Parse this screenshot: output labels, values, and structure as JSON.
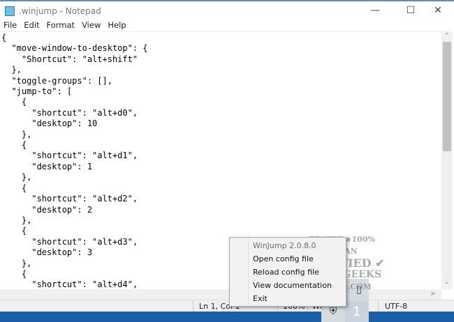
{
  "window": {
    "title": ".winjump - Notepad",
    "controls": [
      "minimize",
      "maximize",
      "close"
    ]
  },
  "menu": [
    "File",
    "Edit",
    "Format",
    "View",
    "Help"
  ],
  "editor": {
    "content": "{\n  \"move-window-to-desktop\": {\n    \"Shortcut\": \"alt+shift\"\n  },\n  \"toggle-groups\": [],\n  \"jump-to\": [\n    {\n      \"shortcut\": \"alt+d0\",\n      \"desktop\": 10\n    },\n    {\n      \"shortcut\": \"alt+d1\",\n      \"desktop\": 1\n    },\n    {\n      \"shortcut\": \"alt+d2\",\n      \"desktop\": 2\n    },\n    {\n      \"shortcut\": \"alt+d3\",\n      \"desktop\": 3\n    },\n    {\n      \"shortcut\": \"alt+d4\","
  },
  "status": {
    "position": "Ln 1, Col 1",
    "zoom": "100%",
    "line_ending": "Wi",
    "encoding": "UTF-8"
  },
  "context_menu": {
    "header": "WinJump 2.0.8.0",
    "items": [
      "Open config file",
      "Reload config file",
      "View documentation",
      "Exit"
    ]
  },
  "tray": {
    "desktop_number": "1",
    "icons": [
      "usb-icon",
      "security-shield-icon"
    ]
  },
  "watermark": {
    "lines": [
      "TESTED★100% CLEAN",
      "CERTIFIED",
      "MAJORGEEKS",
      ".COM"
    ]
  },
  "colors": {
    "taskbar": "#1c5fa8",
    "accent_border": "#5b8fb8"
  }
}
